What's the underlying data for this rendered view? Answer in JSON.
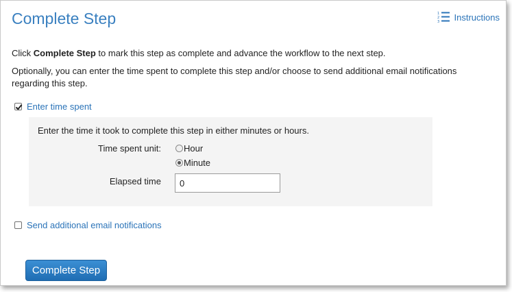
{
  "dialog": {
    "title": "Complete Step",
    "instructions_link": "Instructions",
    "instructions_icon": "numbered-list-icon"
  },
  "intro": {
    "line1_prefix": "Click ",
    "line1_bold": "Complete Step",
    "line1_suffix": " to mark this step as complete and advance the workflow to the next step.",
    "line2": "Optionally, you can enter the time spent to complete this step and/or choose to send additional email notifications regarding this step."
  },
  "time_spent": {
    "checkbox_label": "Enter time spent",
    "checked": true,
    "description": "Enter the time it took to complete this step in either minutes or hours.",
    "unit_label": "Time spent unit:",
    "unit_options": [
      "Hour",
      "Minute"
    ],
    "unit_selected": "Minute",
    "elapsed_label": "Elapsed time",
    "elapsed_value": "0"
  },
  "email": {
    "checkbox_label": "Send additional email notifications",
    "checked": false
  },
  "actions": {
    "complete_label": "Complete Step"
  },
  "colors": {
    "title": "#3a80c0",
    "link": "#2a73b8",
    "primary_button": "#2a7cc4",
    "panel_bg": "#f4f4f4"
  }
}
